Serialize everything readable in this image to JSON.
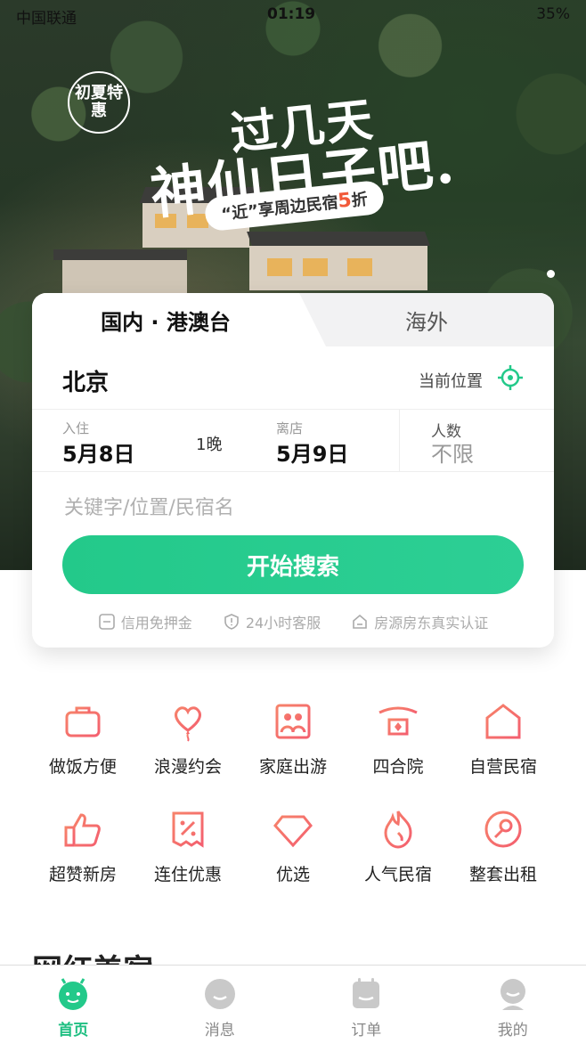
{
  "status_bar": {
    "carrier": "中国联通",
    "time": "01:19",
    "battery": "35%"
  },
  "hero": {
    "badge": "初夏特惠",
    "slogan_line1": "过几天",
    "slogan_line2": "神仙日子吧.",
    "promo_prefix": "“近”享周边民宿",
    "promo_highlight": "5",
    "promo_suffix": "折"
  },
  "search": {
    "tab_domestic": "国内 · 港澳台",
    "tab_overseas": "海外",
    "city": "北京",
    "current_location_label": "当前位置",
    "checkin_label": "入住",
    "checkin_value": "5月8日",
    "nights": "1晚",
    "checkout_label": "离店",
    "checkout_value": "5月9日",
    "guests_label": "人数",
    "guests_value": "不限",
    "keyword_placeholder": "关键字/位置/民宿名",
    "search_button": "开始搜索",
    "guarantees": [
      "信用免押金",
      "24小时客服",
      "房源房东真实认证"
    ]
  },
  "categories": [
    {
      "label": "做饭方便",
      "icon": "cooking-pot-icon"
    },
    {
      "label": "浪漫约会",
      "icon": "heart-balloon-icon"
    },
    {
      "label": "家庭出游",
      "icon": "family-picture-icon"
    },
    {
      "label": "四合院",
      "icon": "courtyard-gate-icon"
    },
    {
      "label": "自营民宿",
      "icon": "house-t-icon"
    },
    {
      "label": "超赞新房",
      "icon": "thumbs-up-icon"
    },
    {
      "label": "连住优惠",
      "icon": "discount-ticket-icon"
    },
    {
      "label": "优选",
      "icon": "diamond-icon"
    },
    {
      "label": "人气民宿",
      "icon": "flame-icon"
    },
    {
      "label": "整套出租",
      "icon": "key-icon"
    }
  ],
  "section_title": "网红美宿",
  "tabbar": [
    {
      "label": "首页",
      "icon": "home-mascot-icon",
      "active": true
    },
    {
      "label": "消息",
      "icon": "message-bubble-icon",
      "active": false
    },
    {
      "label": "订单",
      "icon": "order-calendar-icon",
      "active": false
    },
    {
      "label": "我的",
      "icon": "profile-icon",
      "active": false
    }
  ],
  "colors": {
    "accent": "#23c98a",
    "icon_gradient_start": "#f6826a",
    "icon_gradient_end": "#f45f6f"
  }
}
